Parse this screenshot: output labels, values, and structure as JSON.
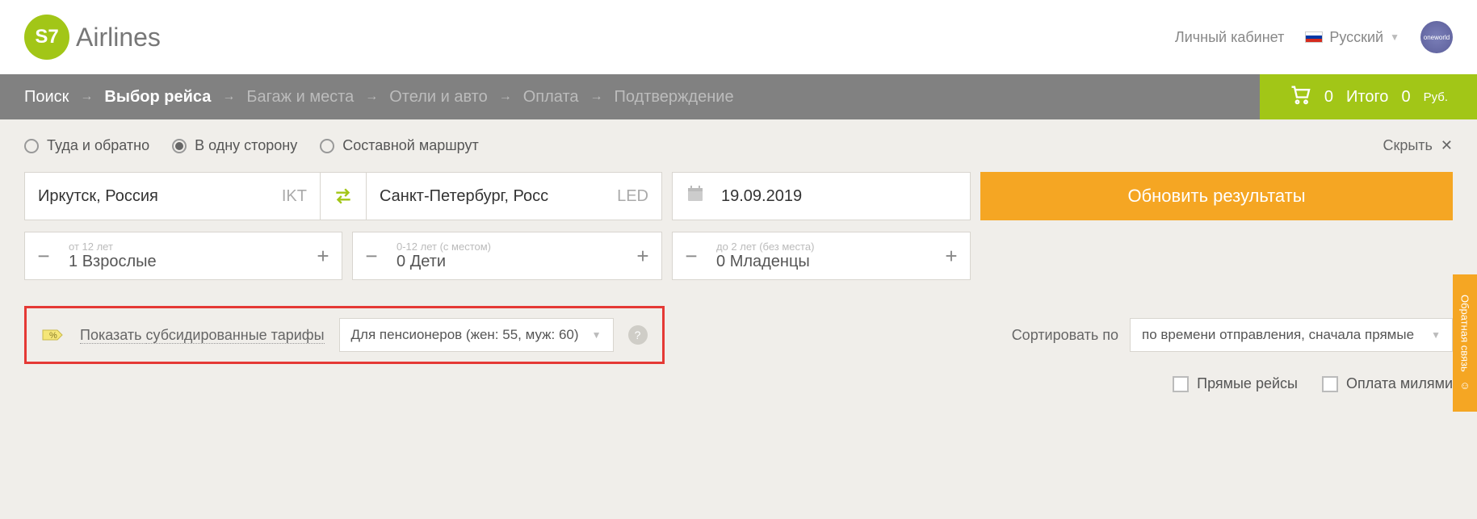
{
  "header": {
    "brand": "Airlines",
    "cabinet": "Личный кабинет",
    "lang": "Русский",
    "oneworld": "oneworld"
  },
  "breadcrumb": {
    "steps": [
      "Поиск",
      "Выбор рейса",
      "Багаж и места",
      "Отели и авто",
      "Оплата",
      "Подтверждение"
    ],
    "cart_count": "0",
    "cart_label": "Итого",
    "cart_amount": "0",
    "cart_currency": "Руб."
  },
  "trip": {
    "roundtrip": "Туда и обратно",
    "oneway": "В одну сторону",
    "multi": "Составной маршрут",
    "hide": "Скрыть"
  },
  "search": {
    "from_value": "Иркутск, Россия",
    "from_code": "IKT",
    "to_value": "Санкт-Петербург, Росс",
    "to_code": "LED",
    "date": "19.09.2019",
    "update_btn": "Обновить результаты"
  },
  "pax": {
    "adult_hint": "от 12 лет",
    "adult_count": "1",
    "adult_label": "Взрослые",
    "child_hint": "0-12 лет (с местом)",
    "child_count": "0",
    "child_label": "Дети",
    "infant_hint": "до 2 лет (без места)",
    "infant_count": "0",
    "infant_label": "Младенцы"
  },
  "filters": {
    "subsidy_prefix": "Показать ",
    "subsidy_link": "субсидированные тарифы",
    "subsidy_select": "Для пенсионеров (жен: 55, муж: 60)",
    "sort_label": "Сортировать по",
    "sort_select": "по времени отправления, сначала прямые",
    "direct": "Прямые рейсы",
    "miles": "Оплата милями"
  },
  "feedback": "Обратная связь"
}
